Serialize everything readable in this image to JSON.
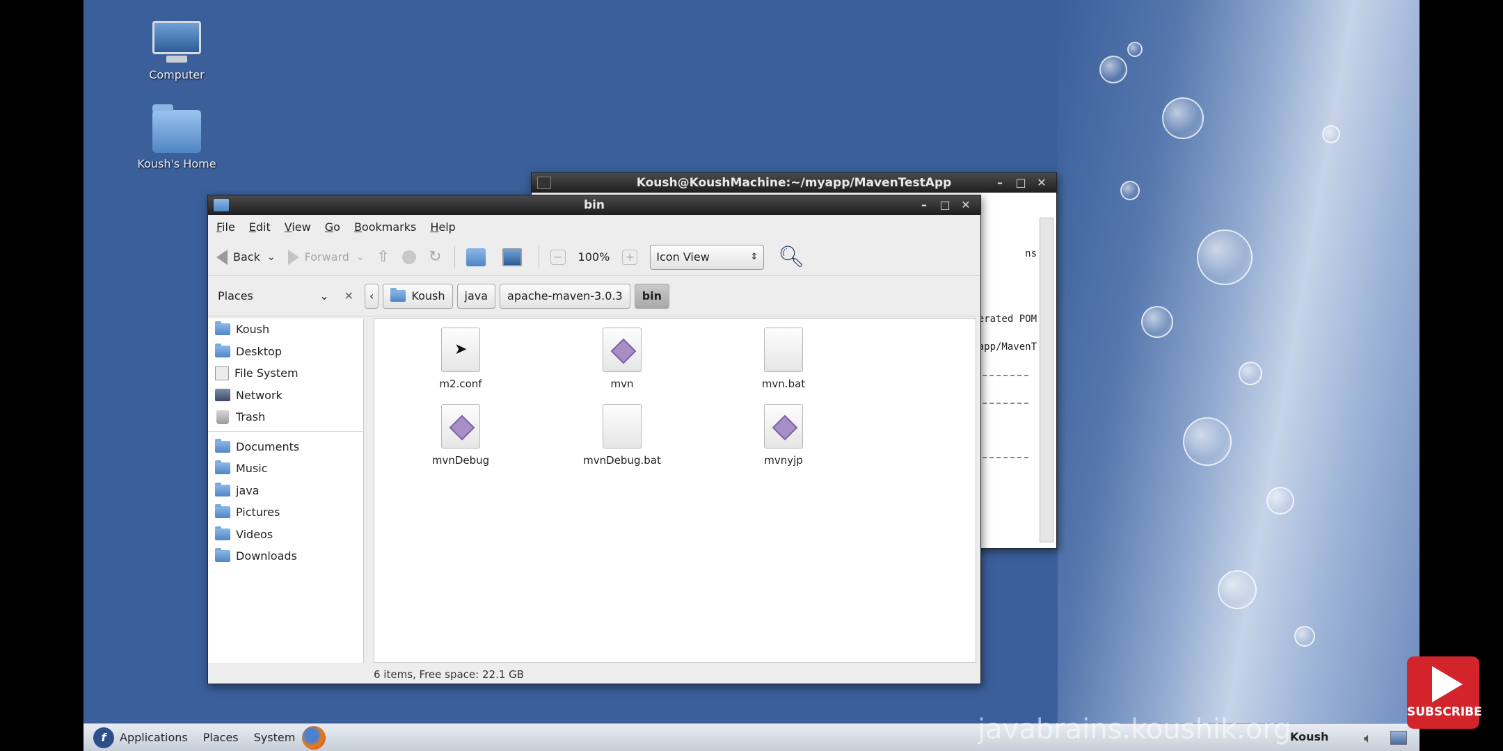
{
  "desktop": {
    "icons": [
      {
        "label": "Computer",
        "icon": "computer-icon"
      },
      {
        "label": "Koush's Home",
        "icon": "home-folder-icon"
      }
    ]
  },
  "terminal": {
    "title": "Koush@KoushMachine:~/myapp/MavenTestApp",
    "lines": [
      "ns",
      "ces from generated POM",
      "ome/Koush/myapp/MavenT"
    ]
  },
  "file_manager": {
    "title": "bin",
    "menu": [
      "File",
      "Edit",
      "View",
      "Go",
      "Bookmarks",
      "Help"
    ],
    "toolbar": {
      "back": "Back",
      "forward": "Forward",
      "zoom": "100%",
      "view_mode": "Icon View"
    },
    "places_label": "Places",
    "breadcrumbs": [
      "Koush",
      "java",
      "apache-maven-3.0.3",
      "bin"
    ],
    "sidebar": {
      "system": [
        {
          "label": "Koush",
          "icon": "home-folder-icon"
        },
        {
          "label": "Desktop",
          "icon": "folder-icon"
        },
        {
          "label": "File System",
          "icon": "drive-icon"
        },
        {
          "label": "Network",
          "icon": "network-icon"
        },
        {
          "label": "Trash",
          "icon": "trash-icon"
        }
      ],
      "bookmarks": [
        {
          "label": "Documents",
          "icon": "folder-icon"
        },
        {
          "label": "Music",
          "icon": "folder-icon"
        },
        {
          "label": "java",
          "icon": "folder-icon"
        },
        {
          "label": "Pictures",
          "icon": "folder-icon"
        },
        {
          "label": "Videos",
          "icon": "folder-icon"
        },
        {
          "label": "Downloads",
          "icon": "folder-icon"
        }
      ]
    },
    "files": [
      {
        "name": "m2.conf",
        "type": "text"
      },
      {
        "name": "mvn",
        "type": "executable"
      },
      {
        "name": "mvn.bat",
        "type": "text"
      },
      {
        "name": "mvnDebug",
        "type": "executable"
      },
      {
        "name": "mvnDebug.bat",
        "type": "text"
      },
      {
        "name": "mvnyjp",
        "type": "executable"
      }
    ],
    "status": "6 items, Free space: 22.1 GB"
  },
  "taskbar": {
    "menus": [
      "Applications",
      "Places",
      "System"
    ],
    "user": "Koush"
  },
  "overlay": {
    "watermark": "javabrains.koushik.org",
    "subscribe": "SUBSCRIBE"
  },
  "colors": {
    "desktop_bg": "#3a5f9a",
    "subscribe_red": "#d3232b"
  }
}
